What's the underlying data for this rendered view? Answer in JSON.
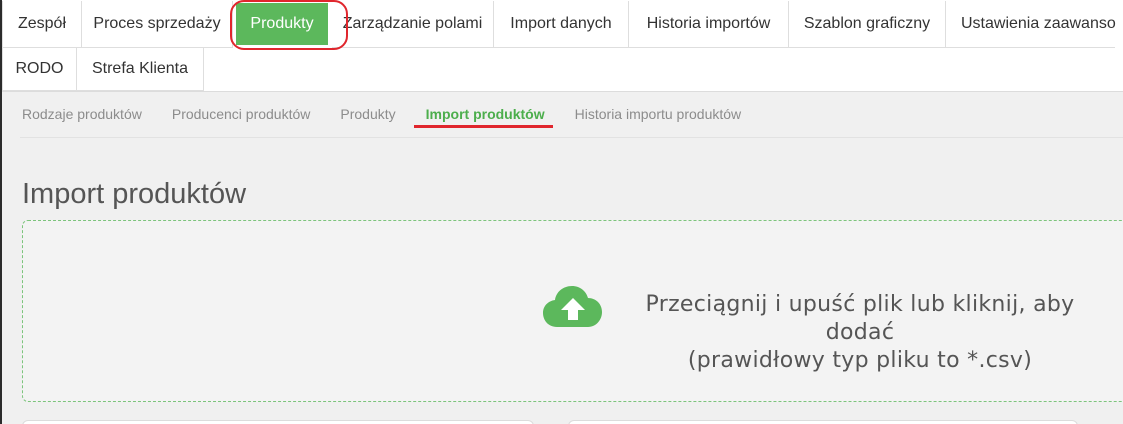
{
  "main_tabs": {
    "row1": [
      {
        "label": "Zespół",
        "active": false
      },
      {
        "label": "Proces sprzedaży",
        "active": false
      },
      {
        "label": "Produkty",
        "active": true
      },
      {
        "label": "Zarządzanie polami",
        "active": false
      },
      {
        "label": "Import danych",
        "active": false
      },
      {
        "label": "Historia importów",
        "active": false
      },
      {
        "label": "Szablon graficzny",
        "active": false
      },
      {
        "label": "Ustawienia zaawanso",
        "active": false
      }
    ],
    "row2": [
      {
        "label": "RODO",
        "active": false
      },
      {
        "label": "Strefa Klienta",
        "active": false
      }
    ]
  },
  "sub_nav": [
    {
      "label": "Rodzaje produktów",
      "active": false
    },
    {
      "label": "Producenci produktów",
      "active": false
    },
    {
      "label": "Produkty",
      "active": false
    },
    {
      "label": "Import produktów",
      "active": true
    },
    {
      "label": "Historia importu produktów",
      "active": false
    }
  ],
  "page": {
    "title": "Import produktów"
  },
  "dropzone": {
    "line1": "Przeciągnij i upuść plik lub kliknij, aby dodać",
    "line2": "(prawidłowy typ pliku to *.csv)",
    "icon": "cloud-upload-icon"
  },
  "colors": {
    "accent_green": "#5cb85c",
    "annotation_red": "#e0262d"
  }
}
